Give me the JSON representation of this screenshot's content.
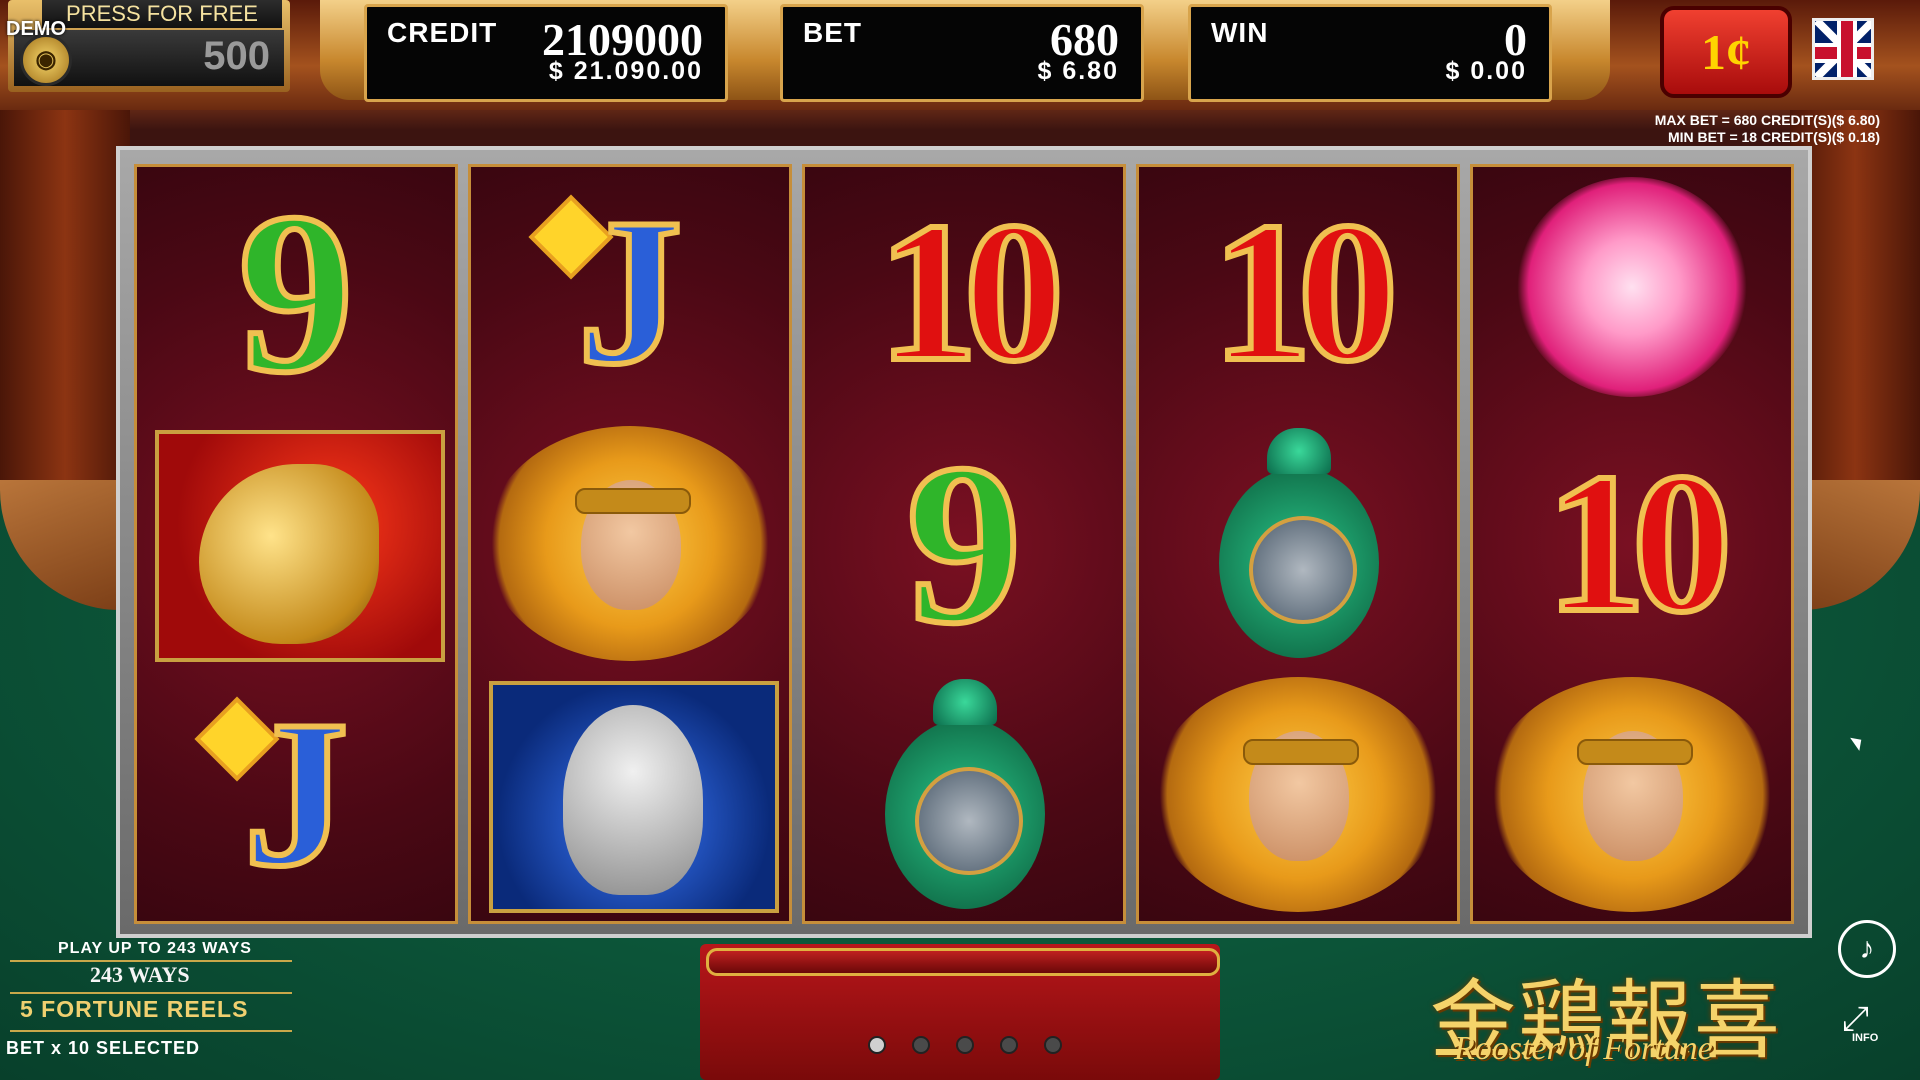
{
  "demo_label": "DEMO",
  "free_play": {
    "label": "PRESS FOR FREE PLAY",
    "value": "500"
  },
  "meters": {
    "credit": {
      "label": "CREDIT",
      "value": "2109000",
      "money": "$ 21.090.00"
    },
    "bet": {
      "label": "BET",
      "value": "680",
      "money": "$ 6.80"
    },
    "win": {
      "label": "WIN",
      "value": "0",
      "money": "$ 0.00"
    }
  },
  "denomination": "1¢",
  "bet_limits": {
    "max": "MAX BET = 680 CREDIT(S)($ 6.80)",
    "min": "MIN BET = 18 CREDIT(S)($ 0.18)"
  },
  "reels": [
    [
      "9",
      "rooster",
      "J"
    ],
    [
      "J",
      "monkey",
      "elephant"
    ],
    [
      "10",
      "9",
      "vase"
    ],
    [
      "10",
      "vase",
      "monkey"
    ],
    [
      "peony",
      "10",
      "monkey"
    ]
  ],
  "ways_panel": {
    "line1": "PLAY UP TO 243 WAYS",
    "line2": "243 WAYS",
    "line3": "5 FORTUNE REELS",
    "line4": "BET x 10 SELECTED"
  },
  "page_dots": 5,
  "active_dot": 0,
  "title": {
    "cn": "金鶏報喜",
    "en": "Rooster of Fortune"
  },
  "info_label": "INFO",
  "icons": {
    "sound": "speaker-icon",
    "fullscreen": "expand-icon",
    "language": "uk-flag-icon"
  },
  "colors": {
    "accent": "#d8a44c",
    "denom_bg": "#d81a10",
    "reel_bg": "#5a0c18"
  }
}
